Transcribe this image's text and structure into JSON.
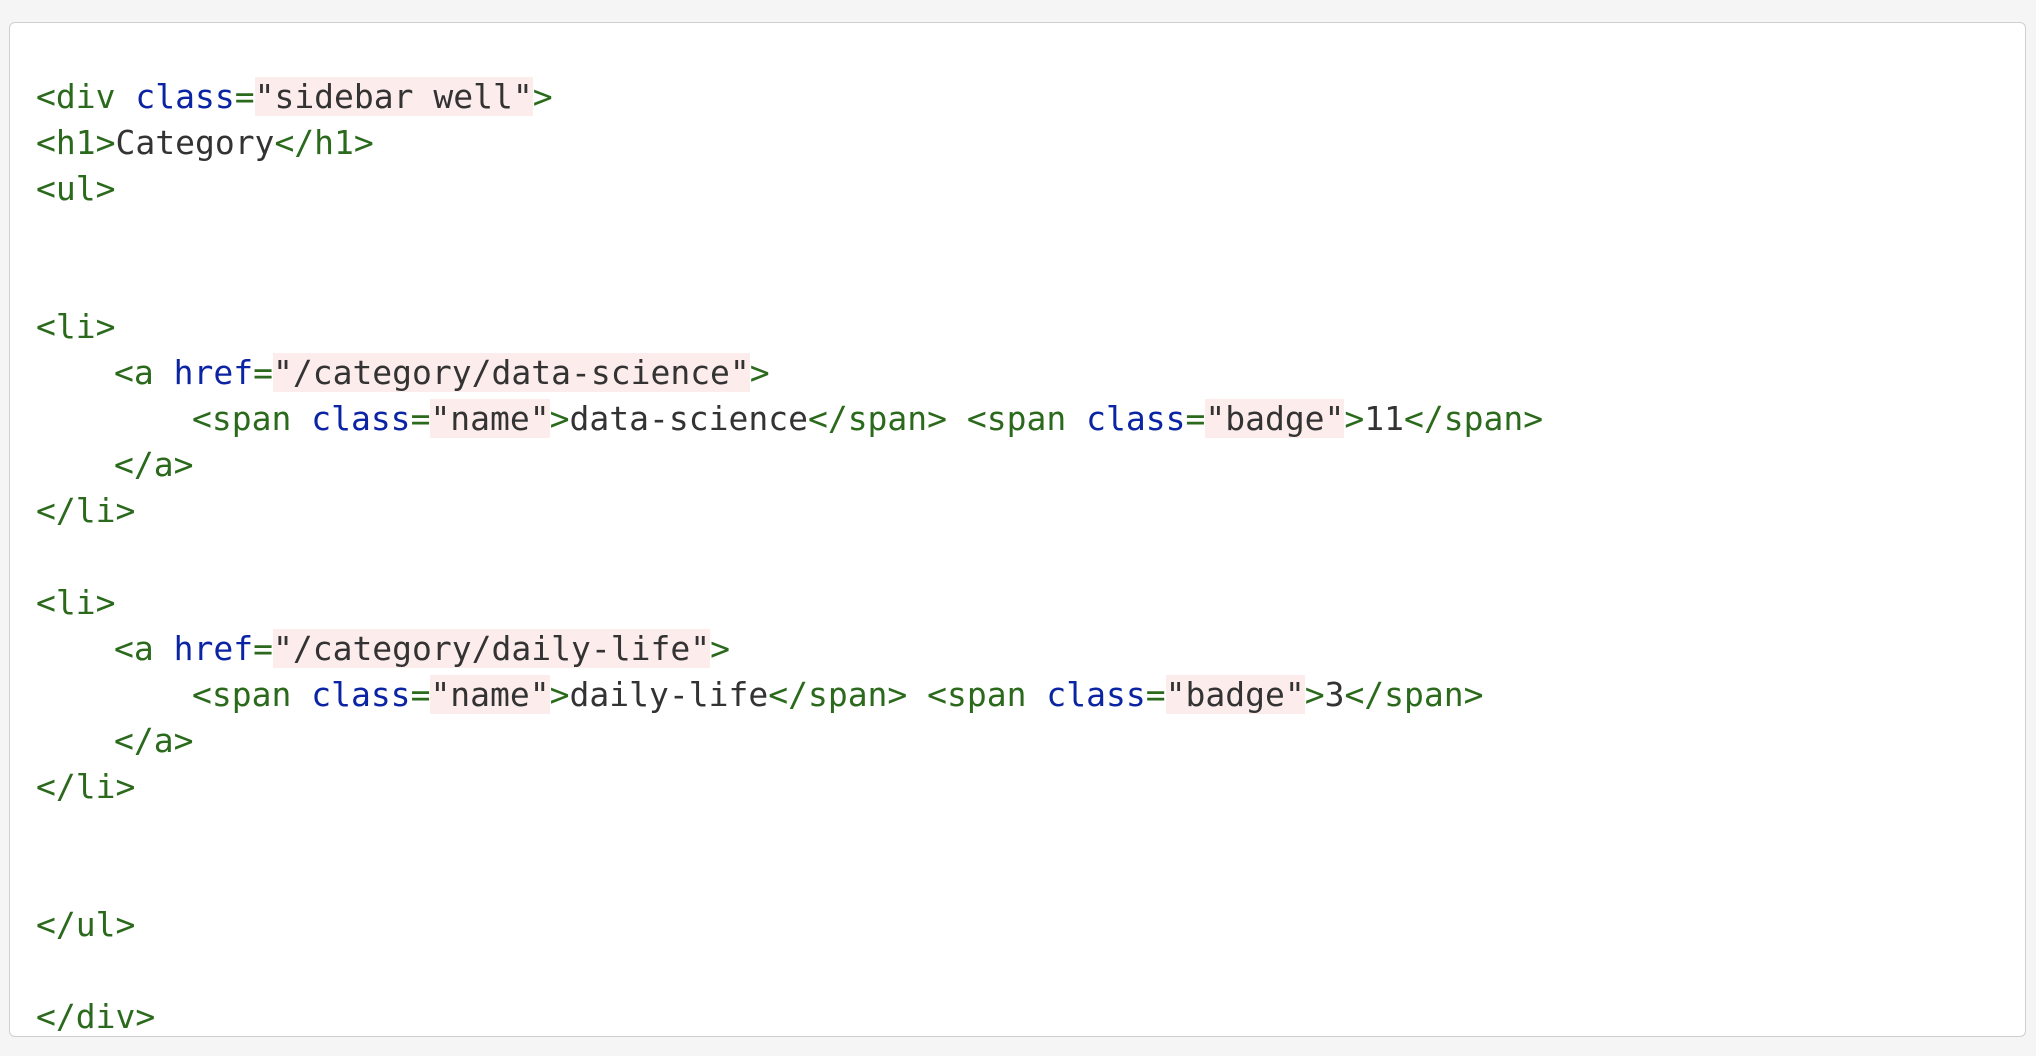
{
  "code": {
    "line1": {
      "open": "<div",
      "attr": " class",
      "eq": "=",
      "val": "\"sidebar well\"",
      "close": ">"
    },
    "line2": {
      "open": "<h1>",
      "text": "Category",
      "close": "</h1>"
    },
    "line3": {
      "tag": "<ul>"
    },
    "items": [
      {
        "li_open": "<li>",
        "a_open": "<a",
        "href_attr": " href",
        "href_eq": "=",
        "href_val": "\"/category/data-science\"",
        "a_close_bracket": ">",
        "span1_open": "<span",
        "span1_attr": " class",
        "span1_eq": "=",
        "span1_val": "\"name\"",
        "span1_gt": ">",
        "span1_text": "data-science",
        "span1_close": "</span>",
        "span2_open": " <span",
        "span2_attr": " class",
        "span2_eq": "=",
        "span2_val": "\"badge\"",
        "span2_gt": ">",
        "span2_text": "11",
        "span2_close": "</span>",
        "a_end": "</a>",
        "li_close": "</li>"
      },
      {
        "li_open": "<li>",
        "a_open": "<a",
        "href_attr": " href",
        "href_eq": "=",
        "href_val": "\"/category/daily-life\"",
        "a_close_bracket": ">",
        "span1_open": "<span",
        "span1_attr": " class",
        "span1_eq": "=",
        "span1_val": "\"name\"",
        "span1_gt": ">",
        "span1_text": "daily-life",
        "span1_close": "</span>",
        "span2_open": " <span",
        "span2_attr": " class",
        "span2_eq": "=",
        "span2_val": "\"badge\"",
        "span2_gt": ">",
        "span2_text": "3",
        "span2_close": "</span>",
        "a_end": "</a>",
        "li_close": "</li>"
      }
    ],
    "ul_close": "</ul>",
    "div_close": "</div>"
  },
  "colors": {
    "tag": "#2b6a1c",
    "attribute": "#0b24a3",
    "string_bg": "#fdecec",
    "text": "#333333",
    "border": "#cfcfcf",
    "page_bg": "#f5f5f5"
  }
}
